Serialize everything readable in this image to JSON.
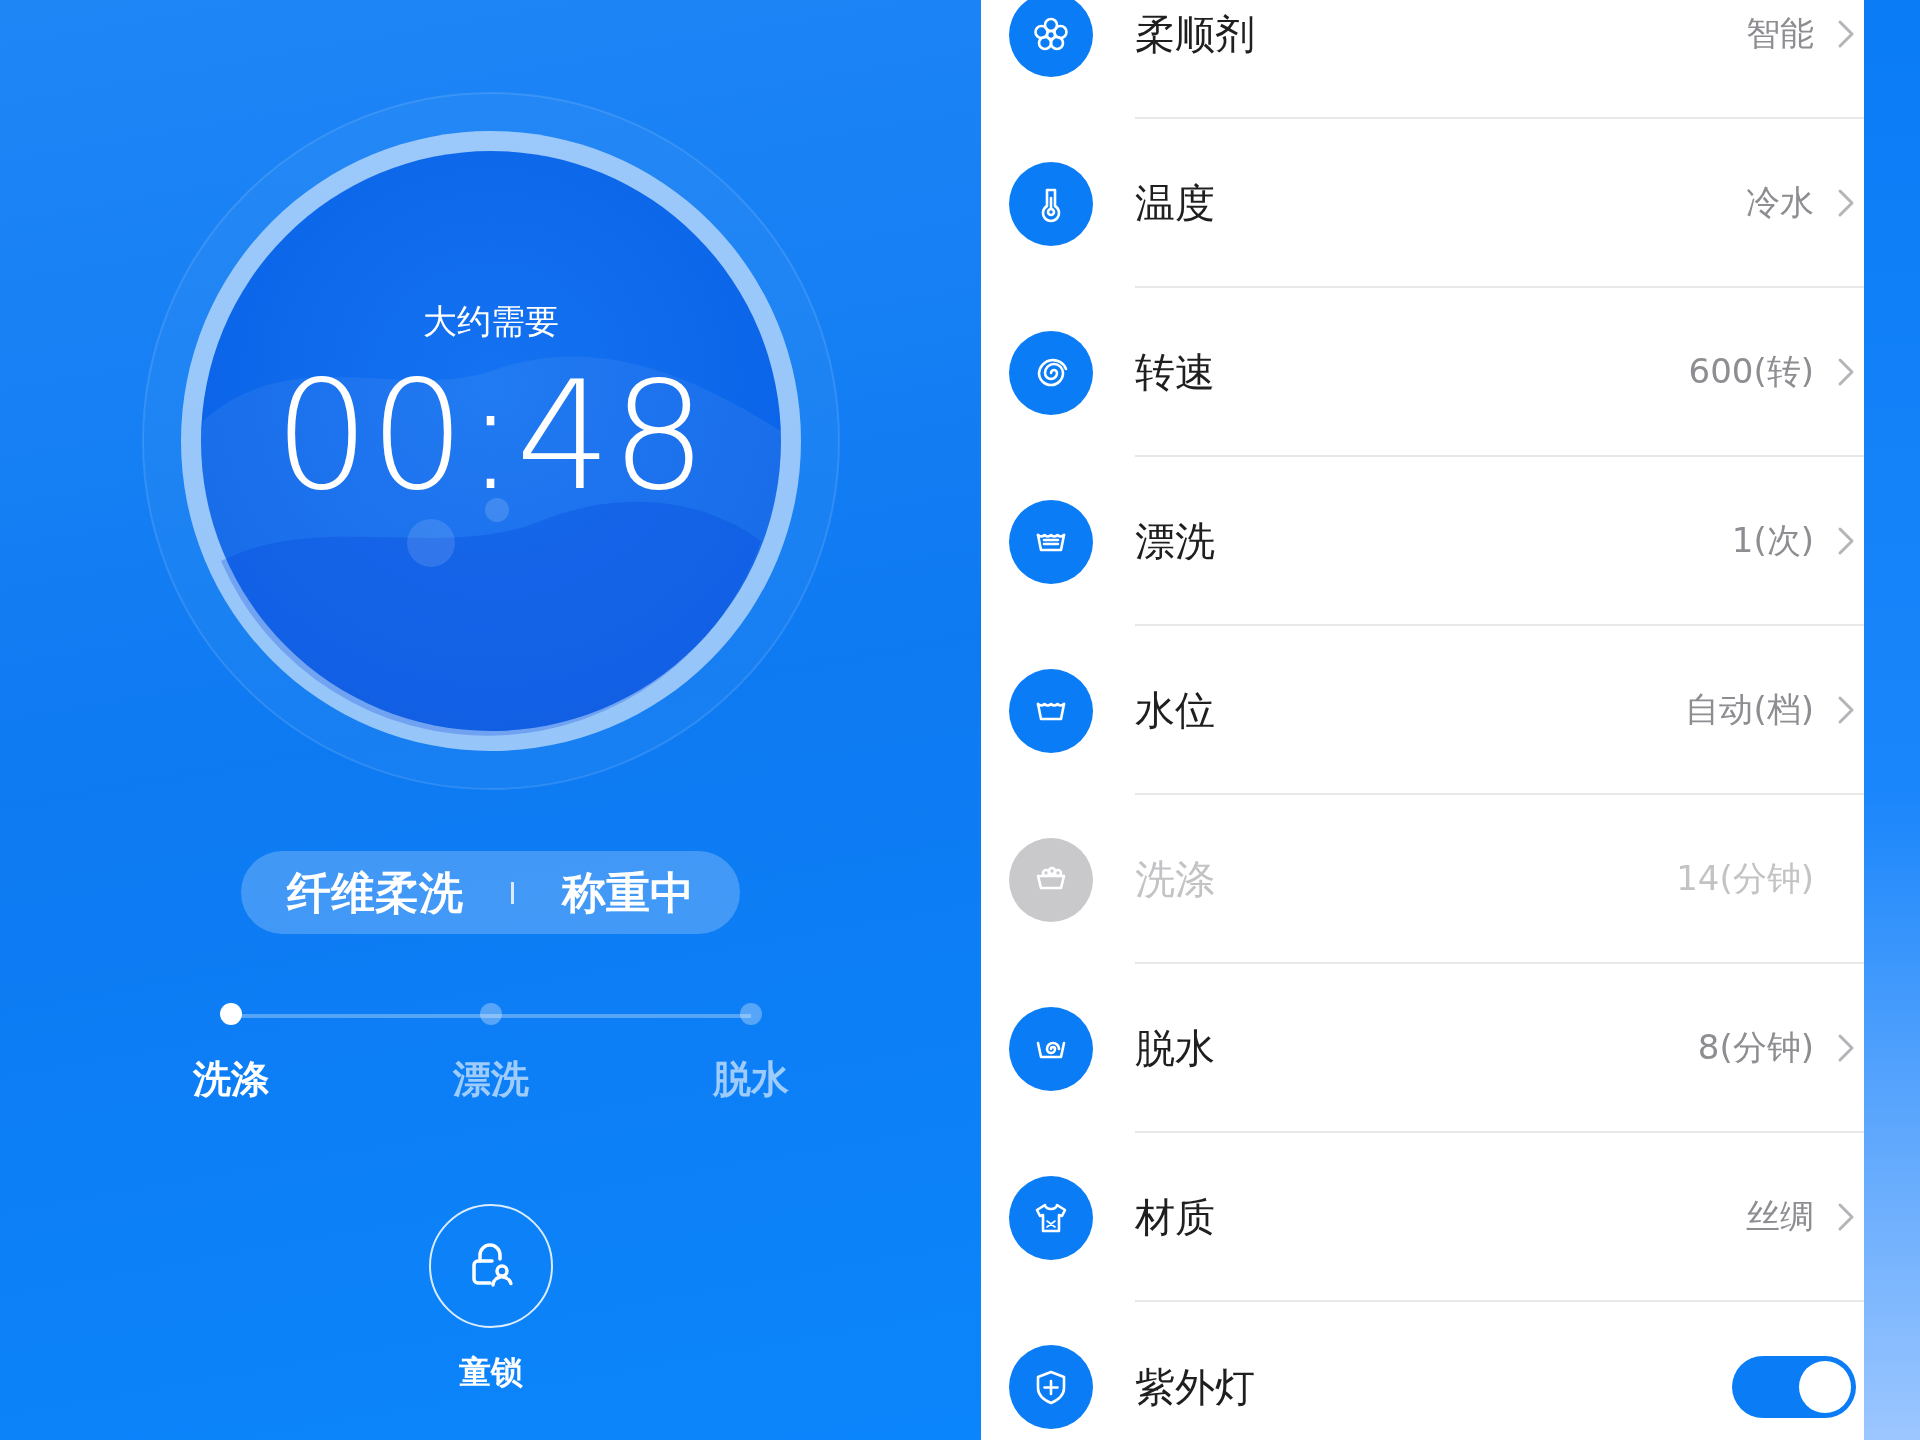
{
  "timer": {
    "caption": "大约需要",
    "time": "00:48"
  },
  "status_pill": {
    "program": "纤维柔洗",
    "state": "称重中"
  },
  "steps": [
    {
      "label": "洗涤",
      "selected": true
    },
    {
      "label": "漂洗",
      "selected": false
    },
    {
      "label": "脱水",
      "selected": false
    }
  ],
  "child_lock": {
    "label": "童锁"
  },
  "settings": [
    {
      "kind": "option",
      "label": "柔顺剂",
      "value": "智能",
      "disabled": false
    },
    {
      "kind": "option",
      "label": "温度",
      "value": "冷水",
      "disabled": false
    },
    {
      "kind": "option",
      "label": "转速",
      "value": "600(转)",
      "disabled": false
    },
    {
      "kind": "option",
      "label": "漂洗",
      "value": "1(次)",
      "disabled": false
    },
    {
      "kind": "option",
      "label": "水位",
      "value": "自动(档)",
      "disabled": false
    },
    {
      "kind": "option",
      "label": "洗涤",
      "value": "14(分钟)",
      "disabled": true
    },
    {
      "kind": "option",
      "label": "脱水",
      "value": "8(分钟)",
      "disabled": false
    },
    {
      "kind": "option",
      "label": "材质",
      "value": "丝绸",
      "disabled": false
    },
    {
      "kind": "toggle",
      "label": "紫外灯",
      "on": true
    }
  ]
}
